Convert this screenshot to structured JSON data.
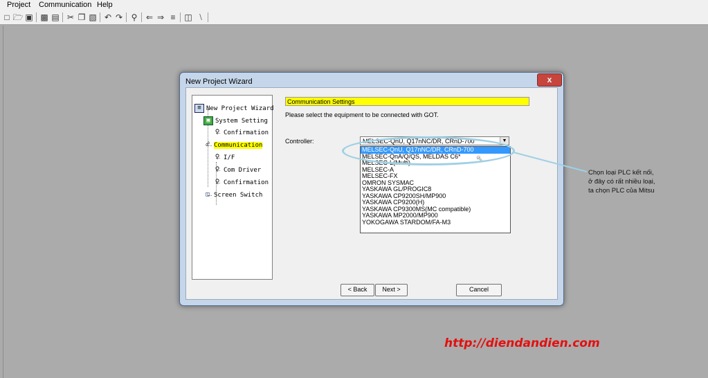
{
  "menu": [
    "Project",
    "Communication",
    "Help"
  ],
  "toolbar_icons": [
    "new-file",
    "open-folder",
    "save",
    "save-as",
    "print-preview",
    "print",
    "cut",
    "copy",
    "paste",
    "undo",
    "redo",
    "zoom",
    "back",
    "forward",
    "align",
    "screen",
    "line"
  ],
  "dialog": {
    "title": "New Project Wizard",
    "close_glyph": "x",
    "tree": [
      {
        "label": "New Project Wizard",
        "icon": "wizard-icon"
      },
      {
        "label": "System Setting",
        "icon": "system-icon"
      },
      {
        "label": "Confirmation",
        "icon": "bulb-icon"
      },
      {
        "label": "Communication",
        "icon": "comm-icon",
        "selected": true
      },
      {
        "label": "I/F",
        "icon": "bulb-icon"
      },
      {
        "label": "Com Driver",
        "icon": "bulb-icon"
      },
      {
        "label": "Confirmation",
        "icon": "bulb-icon"
      },
      {
        "label": "Screen Switch",
        "icon": "screen-icon"
      }
    ],
    "section_title": "Communication Settings",
    "instruction": "Please select the equipment to be connected with GOT.",
    "controller_label": "Controller:",
    "controller_value": "MELSEC-QnU, Q17nNC/DR, CRnD-700",
    "options": [
      "MELSEC-QnU, Q17nNC/DR, CRnD-700",
      "MELSEC-QnA/Q/QS, MELDAS C6*",
      "MELSEC-L(Multi)",
      "MELSEC-A",
      "MELSEC-FX",
      "OMRON SYSMAC",
      "YASKAWA GL/PROGIC8",
      "YASKAWA CP9200SH/MP900",
      "YASKAWA CP9200(H)",
      "YASKAWA CP9300MS(MC compatible)",
      "YASKAWA MP2000/MP900",
      "YOKOGAWA STARDOM/FA-M3"
    ],
    "selected_option_index": 0,
    "buttons": {
      "back": "< Back",
      "next": "Next >",
      "cancel": "Cancel"
    }
  },
  "annotation": {
    "lines": [
      "Chọn loại PLC kết nối,",
      "ở đây có rất nhiều loại,",
      "ta chọn PLC của Mitsu"
    ],
    "color": "#9fd0e4"
  },
  "watermark": "http://diendandien.com"
}
